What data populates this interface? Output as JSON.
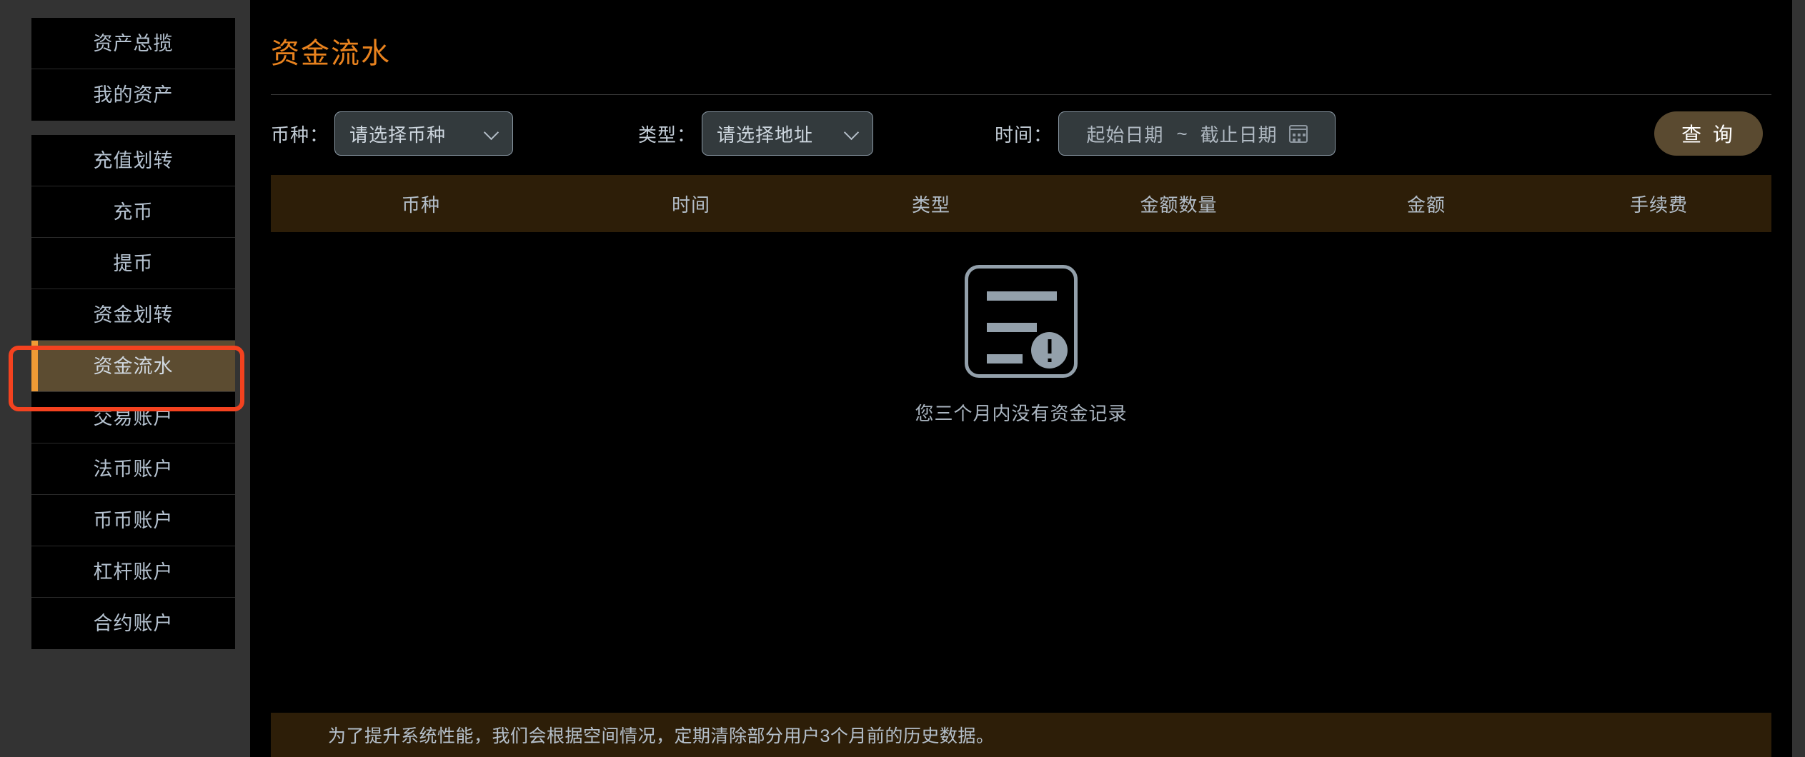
{
  "sidebar": {
    "groups": [
      {
        "items": [
          {
            "label": "资产总揽",
            "active": false
          },
          {
            "label": "我的资产",
            "active": false
          }
        ]
      },
      {
        "items": [
          {
            "label": "充值划转",
            "active": false
          },
          {
            "label": "充币",
            "active": false
          },
          {
            "label": "提币",
            "active": false
          },
          {
            "label": "资金划转",
            "active": false
          },
          {
            "label": "资金流水",
            "active": true
          },
          {
            "label": "交易账户",
            "active": false
          },
          {
            "label": "法币账户",
            "active": false
          },
          {
            "label": "币币账户",
            "active": false
          },
          {
            "label": "杠杆账户",
            "active": false
          },
          {
            "label": "合约账户",
            "active": false
          }
        ]
      }
    ]
  },
  "main": {
    "page_title": "资金流水",
    "filters": {
      "currency": {
        "label": "币种：",
        "placeholder": "请选择币种",
        "chevron_icon": "chevron-down-icon"
      },
      "type": {
        "label": "类型：",
        "placeholder": "请选择地址",
        "chevron_icon": "chevron-down-icon"
      },
      "date": {
        "label": "时间：",
        "start_placeholder": "起始日期",
        "separator": "~",
        "end_placeholder": "截止日期",
        "calendar_icon": "calendar-icon"
      },
      "query_button": "查 询"
    },
    "table": {
      "columns": [
        "币种",
        "时间",
        "类型",
        "金额数量",
        "金额",
        "手续费"
      ],
      "rows": []
    },
    "empty_state": {
      "icon": "document-warning-icon",
      "message": "您三个月内没有资金记录"
    },
    "notice": "为了提升系统性能，我们会根据空间情况，定期清除部分用户3个月前的历史数据。"
  },
  "colors": {
    "accent_orange": "#e8821e",
    "active_bar": "#ef9b35",
    "active_bg": "#5c4c31",
    "table_header_bg": "#2d1e08",
    "annotation_red": "#f4421f",
    "panel_bg": "#000000",
    "page_bg": "#333333"
  }
}
